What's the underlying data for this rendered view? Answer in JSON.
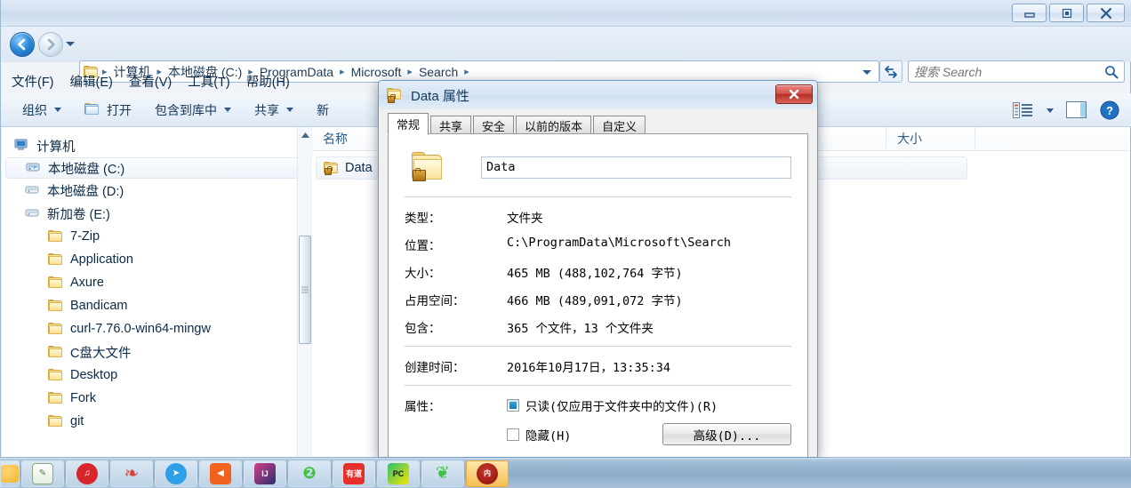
{
  "window": {
    "controls": {
      "minimize": "minimize-button",
      "maximize": "maximize-button",
      "close": "close-button"
    }
  },
  "address": {
    "breadcrumbs": [
      {
        "label": "计算机"
      },
      {
        "label": "本地磁盘 (C:)"
      },
      {
        "label": "ProgramData"
      },
      {
        "label": "Microsoft"
      },
      {
        "label": "Search"
      }
    ],
    "separator": "▸"
  },
  "search": {
    "placeholder": "搜索 Search",
    "value": ""
  },
  "menubar": {
    "items": [
      "文件(F)",
      "编辑(E)",
      "查看(V)",
      "工具(T)",
      "帮助(H)"
    ]
  },
  "commandbar": {
    "items": [
      {
        "label": "组织",
        "has_caret": true,
        "icon": "none"
      },
      {
        "label": "打开",
        "has_caret": false,
        "icon": "open-folder-icon"
      },
      {
        "label": "包含到库中",
        "has_caret": true,
        "icon": "none"
      },
      {
        "label": "共享",
        "has_caret": true,
        "icon": "none"
      },
      {
        "label": "新",
        "has_caret": false,
        "icon": "none"
      }
    ],
    "right_icons": [
      "view-list-icon",
      "view-dropdown-caret",
      "preview-pane-icon",
      "help-icon"
    ]
  },
  "navpane": {
    "items": [
      {
        "label": "计算机",
        "level": 0,
        "icon": "computer-icon",
        "selected": false
      },
      {
        "label": "本地磁盘 (C:)",
        "level": 1,
        "icon": "drive-system-icon",
        "selected": true
      },
      {
        "label": "本地磁盘 (D:)",
        "level": 1,
        "icon": "drive-icon",
        "selected": false
      },
      {
        "label": "新加卷 (E:)",
        "level": 1,
        "icon": "drive-icon",
        "selected": false
      },
      {
        "label": "7-Zip",
        "level": 2,
        "icon": "folder-icon",
        "selected": false
      },
      {
        "label": "Application",
        "level": 2,
        "icon": "folder-icon",
        "selected": false
      },
      {
        "label": "Axure",
        "level": 2,
        "icon": "folder-icon",
        "selected": false
      },
      {
        "label": "Bandicam",
        "level": 2,
        "icon": "folder-icon",
        "selected": false
      },
      {
        "label": "curl-7.76.0-win64-mingw",
        "level": 2,
        "icon": "folder-icon",
        "selected": false
      },
      {
        "label": "C盘大文件",
        "level": 2,
        "icon": "folder-icon",
        "selected": false
      },
      {
        "label": "Desktop",
        "level": 2,
        "icon": "folder-icon",
        "selected": false
      },
      {
        "label": "Fork",
        "level": 2,
        "icon": "folder-icon",
        "selected": false
      },
      {
        "label": "git",
        "level": 2,
        "icon": "folder-icon",
        "selected": false
      }
    ]
  },
  "filelist": {
    "columns": [
      "名称",
      "大小"
    ],
    "rows": [
      {
        "name": "Data",
        "size": "",
        "icon": "locked-folder-icon",
        "selected": true
      }
    ]
  },
  "dialog": {
    "title": "Data 属性",
    "title_icon": "locked-folder-icon",
    "close_label": "✕",
    "tabs": [
      {
        "label": "常规",
        "active": true
      },
      {
        "label": "共享",
        "active": false
      },
      {
        "label": "安全",
        "active": false
      },
      {
        "label": "以前的版本",
        "active": false
      },
      {
        "label": "自定义",
        "active": false
      }
    ],
    "name_value": "Data",
    "fields": [
      {
        "label": "类型：",
        "value": "文件夹"
      },
      {
        "label": "位置：",
        "value": "C:\\ProgramData\\Microsoft\\Search"
      },
      {
        "label": "大小：",
        "value": "465 MB (488,102,764 字节)"
      },
      {
        "label": "占用空间：",
        "value": "466 MB (489,091,072 字节)"
      },
      {
        "label": "包含：",
        "value": "365 个文件，13 个文件夹"
      }
    ],
    "created": {
      "label": "创建时间：",
      "value": "2016年10月17日，13:35:34"
    },
    "attributes": {
      "label": "属性：",
      "readonly": {
        "label": "只读(仅应用于文件夹中的文件)(R)",
        "state": "mixed"
      },
      "hidden": {
        "label": "隐藏(H)",
        "state": "unchecked"
      },
      "advanced_button": "高级(D)..."
    }
  },
  "taskbar": {
    "buttons": [
      {
        "name": "taskbar-app-partial",
        "glyph": "",
        "color": "#f0b429",
        "partial": true,
        "active": false
      },
      {
        "name": "taskbar-app-editor",
        "glyph": "✎",
        "color": "#8fbf6a",
        "partial": false,
        "active": false
      },
      {
        "name": "taskbar-app-netease-music",
        "glyph": "♫",
        "color": "#d8252c",
        "partial": false,
        "active": false
      },
      {
        "name": "taskbar-app-snail",
        "glyph": "◔",
        "color": "#d9443c",
        "partial": false,
        "active": false
      },
      {
        "name": "taskbar-app-telegram",
        "glyph": "➤",
        "color": "#2f9fe8",
        "partial": false,
        "active": false
      },
      {
        "name": "taskbar-app-media",
        "glyph": "◀",
        "color": "#f2621f",
        "partial": false,
        "active": false
      },
      {
        "name": "taskbar-app-intellij",
        "glyph": "IJ",
        "color": "#d4408c",
        "partial": false,
        "active": false
      },
      {
        "name": "taskbar-app-wechat",
        "glyph": "⚉",
        "color": "#3fc13f",
        "partial": false,
        "active": false
      },
      {
        "name": "taskbar-app-youdao",
        "glyph": "有道",
        "color": "#e8302a",
        "partial": false,
        "active": false
      },
      {
        "name": "taskbar-app-pycharm",
        "glyph": "PC",
        "color": "#2fbf71",
        "partial": false,
        "active": false
      },
      {
        "name": "taskbar-app-baidu-netdisk",
        "glyph": "❦",
        "color": "#3fc13f",
        "partial": false,
        "active": false
      },
      {
        "name": "taskbar-app-active",
        "glyph": "●",
        "color": "#9c1d14",
        "partial": false,
        "active": true
      }
    ]
  },
  "colors": {
    "accent": "#2f8ddd",
    "titlebar": "#d3e0f0",
    "dialog_bg": "#f0f0f0",
    "close_red": "#b72f27",
    "checkbox_teal": "#1679b2"
  }
}
